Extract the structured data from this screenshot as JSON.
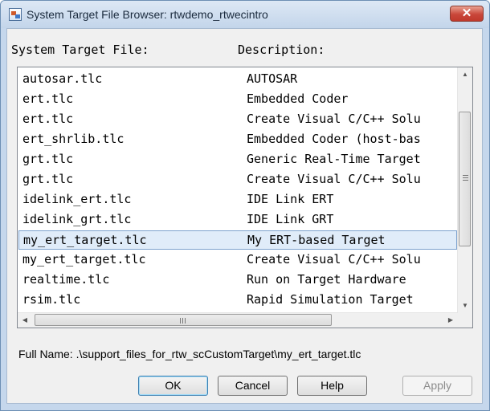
{
  "window": {
    "title": "System Target File Browser: rtwdemo_rtwecintro",
    "close_glyph": "✕"
  },
  "headers": {
    "file": "System Target File:",
    "description": "Description:"
  },
  "list": {
    "rows": [
      {
        "file": "autosar.tlc",
        "description": "AUTOSAR",
        "selected": false
      },
      {
        "file": "ert.tlc",
        "description": "Embedded Coder",
        "selected": false
      },
      {
        "file": "ert.tlc",
        "description": "Create Visual C/C++ Solu",
        "selected": false
      },
      {
        "file": "ert_shrlib.tlc",
        "description": "Embedded Coder (host-bas",
        "selected": false
      },
      {
        "file": "grt.tlc",
        "description": "Generic Real-Time Target",
        "selected": false
      },
      {
        "file": "grt.tlc",
        "description": "Create Visual C/C++ Solu",
        "selected": false
      },
      {
        "file": "idelink_ert.tlc",
        "description": "IDE Link ERT",
        "selected": false
      },
      {
        "file": "idelink_grt.tlc",
        "description": "IDE Link GRT",
        "selected": false
      },
      {
        "file": "my_ert_target.tlc",
        "description": "My ERT-based Target",
        "selected": true
      },
      {
        "file": "my_ert_target.tlc",
        "description": "Create Visual C/C++ Solu",
        "selected": false
      },
      {
        "file": "realtime.tlc",
        "description": "Run on Target Hardware",
        "selected": false
      },
      {
        "file": "rsim.tlc",
        "description": "Rapid Simulation Target",
        "selected": false
      }
    ]
  },
  "full_name": "Full Name:  .\\support_files_for_rtw_scCustomTarget\\my_ert_target.tlc",
  "buttons": {
    "ok": "OK",
    "cancel": "Cancel",
    "help": "Help",
    "apply": "Apply"
  },
  "colors": {
    "selection_bg": "#e0ecf9",
    "selection_border": "#7da2ce",
    "close_button": "#c9473a"
  }
}
